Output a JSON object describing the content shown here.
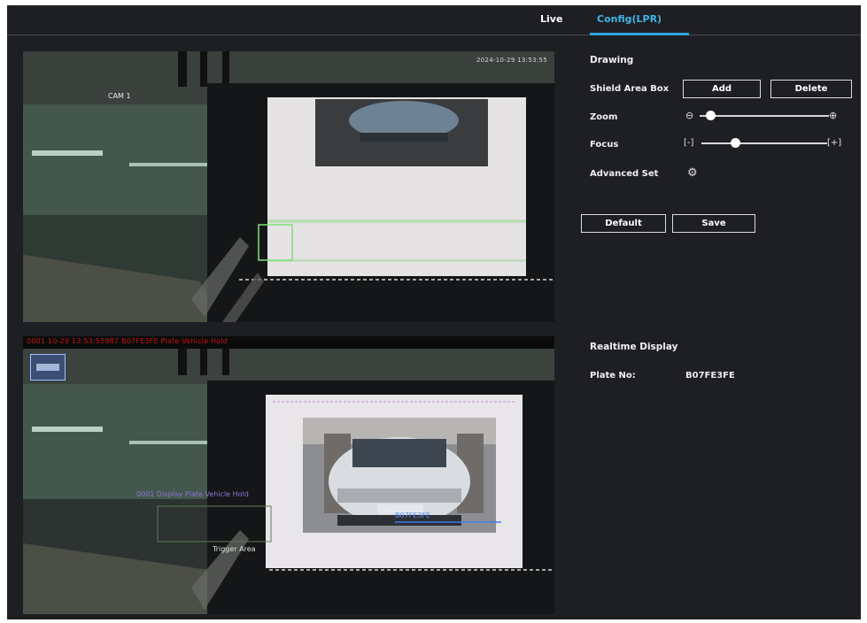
{
  "tabs": [
    {
      "label": "Live",
      "active": false
    },
    {
      "label": "Config(LPR)",
      "active": true
    }
  ],
  "video": {
    "top": {
      "timestamp": "2024-10-29 13:53:55",
      "camera_label": "CAM 1"
    },
    "status_strip": "0001 10-29 13:53:55987 B07FE3FE Plate Vehicle Hold",
    "bottom": {
      "overlay_text_1": "0001 Display Plate Vehicle Hold",
      "overlay_text_2": "Trigger Area",
      "overlay_text_3": "B07FE3FE"
    }
  },
  "panel": {
    "drawing_title": "Drawing",
    "shield_label": "Shield Area Box",
    "add_label": "Add",
    "delete_label": "Delete",
    "zoom_label": "Zoom",
    "zoom_level": 0.05,
    "focus_label": "Focus",
    "focus_level": 0.25,
    "advanced_label": "Advanced Set",
    "default_label": "Default",
    "save_label": "Save",
    "realtime_title": "Realtime Display",
    "plate_label": "Plate No:",
    "plate_value": "B07FE3FE"
  },
  "icons": {
    "zoom_out": "zoom-out-icon",
    "zoom_in": "zoom-in-icon",
    "focus_minus": "focus-near-icon",
    "focus_plus": "focus-far-icon",
    "advanced": "gear-icon"
  },
  "colors": {
    "accent": "#2fa6dc",
    "background": "#1e1f23",
    "alert_text": "#c51414"
  }
}
